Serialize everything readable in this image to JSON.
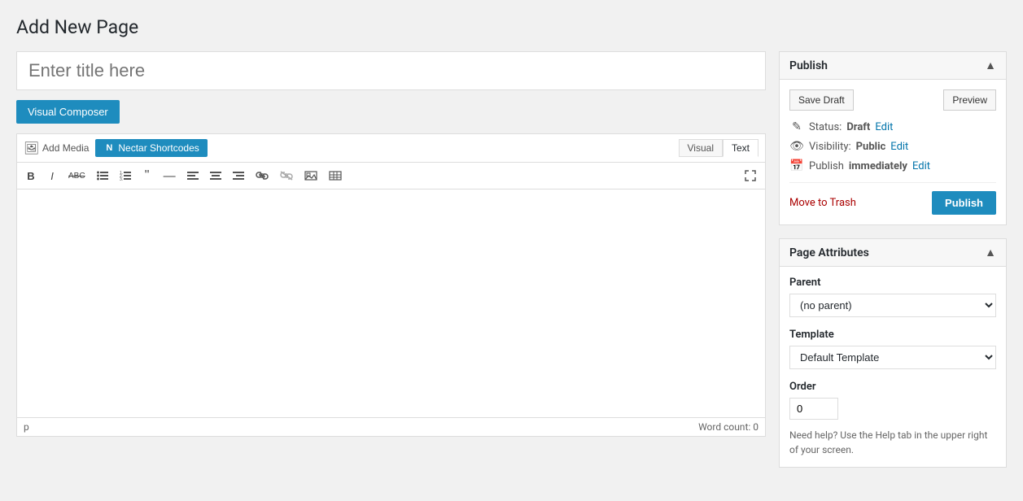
{
  "page": {
    "title": "Add New Page"
  },
  "title_input": {
    "placeholder": "Enter title here"
  },
  "visual_composer": {
    "label": "Visual Composer"
  },
  "editor": {
    "add_media": "Add Media",
    "nectar_shortcodes": "Nectar Shortcodes",
    "tab_visual": "Visual",
    "tab_text": "Text",
    "footer_tag": "p",
    "word_count": "Word count: 0",
    "format_buttons": [
      {
        "name": "bold",
        "symbol": "B",
        "title": "Bold"
      },
      {
        "name": "italic",
        "symbol": "I",
        "title": "Italic"
      },
      {
        "name": "strikethrough",
        "symbol": "abc",
        "title": "Strikethrough"
      },
      {
        "name": "unordered-list",
        "symbol": "≡",
        "title": "Unordered List"
      },
      {
        "name": "ordered-list",
        "symbol": "≣",
        "title": "Ordered List"
      },
      {
        "name": "blockquote",
        "symbol": "❝",
        "title": "Blockquote"
      },
      {
        "name": "horizontal-rule",
        "symbol": "—",
        "title": "Horizontal Rule"
      },
      {
        "name": "align-left",
        "symbol": "≡",
        "title": "Align Left"
      },
      {
        "name": "align-center",
        "symbol": "≡",
        "title": "Align Center"
      },
      {
        "name": "align-right",
        "symbol": "≡",
        "title": "Align Right"
      },
      {
        "name": "link",
        "symbol": "🔗",
        "title": "Insert Link"
      },
      {
        "name": "unlink",
        "symbol": "⛓",
        "title": "Remove Link"
      },
      {
        "name": "insert-image",
        "symbol": "▬",
        "title": "Insert Image"
      },
      {
        "name": "insert-table",
        "symbol": "⊞",
        "title": "Insert Table"
      }
    ]
  },
  "publish_box": {
    "title": "Publish",
    "save_draft_label": "Save Draft",
    "preview_label": "Preview",
    "status_label": "Status:",
    "status_value": "Draft",
    "status_edit": "Edit",
    "visibility_label": "Visibility:",
    "visibility_value": "Public",
    "visibility_edit": "Edit",
    "publish_label": "Publish",
    "publish_timing": "immediately",
    "publish_timing_edit": "Edit",
    "move_to_trash": "Move to Trash",
    "publish_btn": "Publish"
  },
  "page_attributes": {
    "title": "Page Attributes",
    "parent_label": "Parent",
    "parent_options": [
      "(no parent)"
    ],
    "parent_selected": "(no parent)",
    "template_label": "Template",
    "template_options": [
      "Default Template"
    ],
    "template_selected": "Default Template",
    "order_label": "Order",
    "order_value": "0",
    "help_text": "Need help? Use the Help tab in the upper right of your screen."
  },
  "icons": {
    "pencil": "✎",
    "eye": "👁",
    "calendar": "📅",
    "collapse": "▲",
    "expand": "⤢",
    "image_upload": "🖼",
    "n": "N"
  }
}
